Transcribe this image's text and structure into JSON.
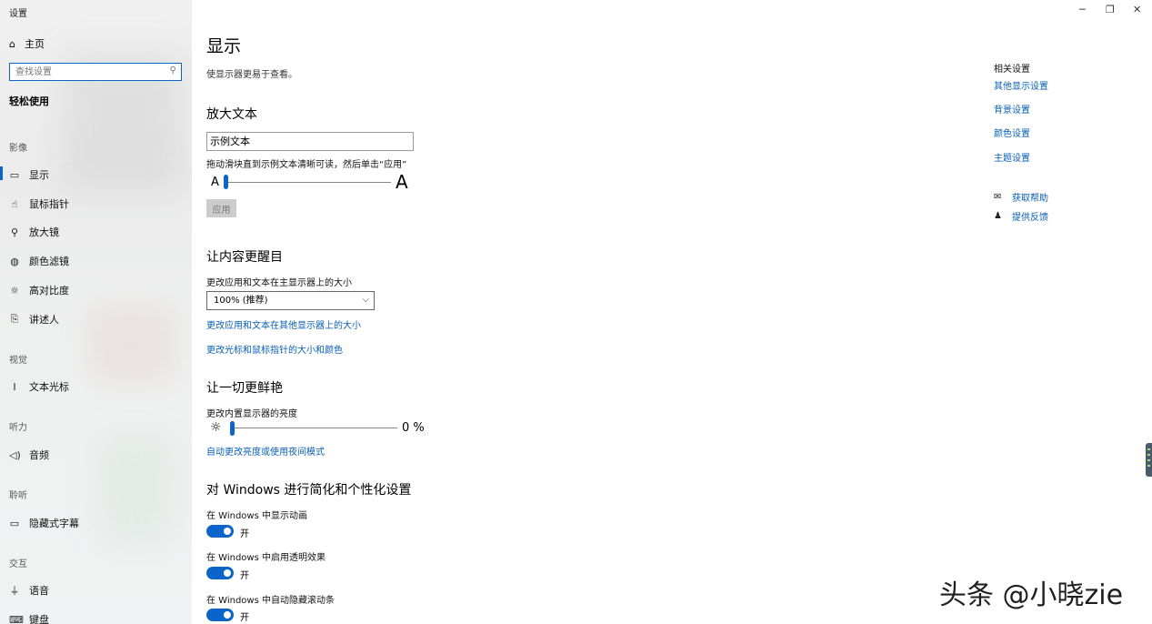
{
  "window": {
    "title": "设置",
    "controls": {
      "minimize": "─",
      "restore": "❐",
      "close": "✕"
    }
  },
  "sidebar": {
    "home_label": "主页",
    "search_placeholder": "查找设置",
    "category": "轻松使用",
    "sections": [
      {
        "label": "影像",
        "items": [
          {
            "label": "显示",
            "icon": "monitor-icon",
            "glyph": "🖵"
          },
          {
            "label": "鼠标指针",
            "icon": "pointer-icon",
            "glyph": "☝"
          },
          {
            "label": "放大镜",
            "icon": "magnifier-icon",
            "glyph": "🔍"
          },
          {
            "label": "颜色滤镜",
            "icon": "palette-icon",
            "glyph": "◍"
          },
          {
            "label": "高对比度",
            "icon": "contrast-icon",
            "glyph": "☼"
          },
          {
            "label": "讲述人",
            "icon": "narrator-icon",
            "glyph": "⎘"
          }
        ]
      },
      {
        "label": "视觉",
        "items": [
          {
            "label": "文本光标",
            "icon": "text-cursor-icon",
            "glyph": "I"
          }
        ]
      },
      {
        "label": "听力",
        "items": [
          {
            "label": "音频",
            "icon": "speaker-icon",
            "glyph": "🔊"
          }
        ]
      },
      {
        "label": "聆听",
        "items": [
          {
            "label": "隐藏式字幕",
            "icon": "captions-icon",
            "glyph": "▭"
          }
        ]
      },
      {
        "label": "交互",
        "items": [
          {
            "label": "语音",
            "icon": "microphone-icon",
            "glyph": "🎙"
          },
          {
            "label": "键盘",
            "icon": "keyboard-icon",
            "glyph": "⌨"
          }
        ]
      }
    ]
  },
  "main": {
    "title": "显示",
    "description": "使显示器更易于查看。",
    "text_size": {
      "heading": "放大文本",
      "sample_text": "示例文本",
      "instruction": "拖动滑块直到示例文本清晰可读，然后单击“应用”",
      "small_a": "A",
      "big_a": "A",
      "slider_value_fraction": 0,
      "apply_label": "应用"
    },
    "bigger": {
      "heading": "让内容更醒目",
      "scale_label": "更改应用和文本在主显示器上的大小",
      "scale_value": "100% (推荐)",
      "link_other_displays": "更改应用和文本在其他显示器上的大小",
      "link_pointer": "更改光标和鼠标指针的大小和颜色"
    },
    "brighter": {
      "heading": "让一切更鲜艳",
      "brightness_label": "更改内置显示器的亮度",
      "brightness_value": "0 %",
      "brightness_fraction": 0,
      "link_night_light": "自动更改亮度或使用夜间模式"
    },
    "personalize": {
      "heading": "对 Windows 进行简化和个性化设置",
      "toggles": [
        {
          "label": "在 Windows 中显示动画",
          "state": "开",
          "on": true
        },
        {
          "label": "在 Windows 中启用透明效果",
          "state": "开",
          "on": true
        },
        {
          "label": "在 Windows 中自动隐藏滚动条",
          "state": "开",
          "on": true
        }
      ]
    }
  },
  "related": {
    "heading": "相关设置",
    "links": [
      "其他显示设置",
      "背景设置",
      "颜色设置",
      "主题设置"
    ],
    "help": [
      {
        "label": "获取帮助",
        "icon": "help-chat-icon",
        "glyph": "💬"
      },
      {
        "label": "提供反馈",
        "icon": "feedback-icon",
        "glyph": "♟"
      }
    ]
  },
  "watermark": "头条 @小晓zie",
  "colors": {
    "accent": "#0a64c9",
    "link": "#0a5fb4"
  }
}
